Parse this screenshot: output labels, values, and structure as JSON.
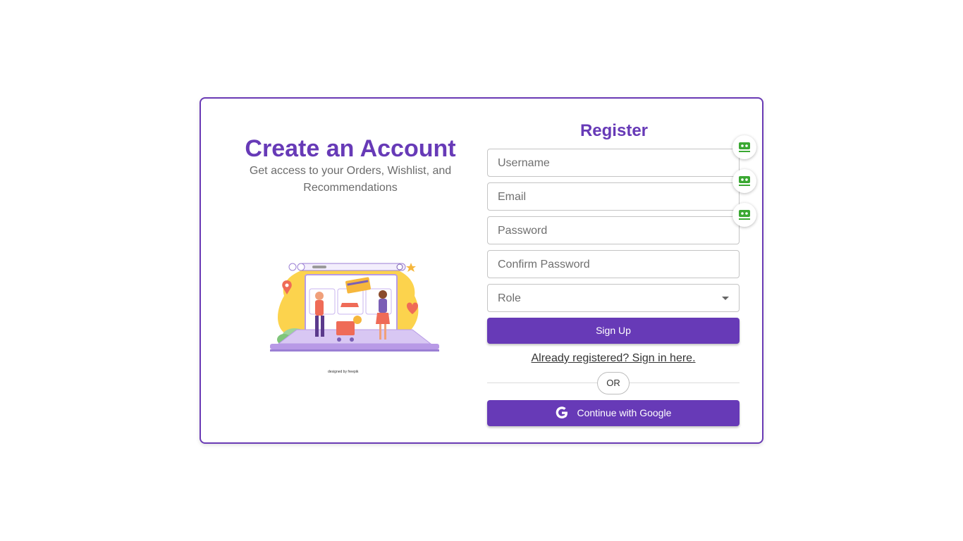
{
  "left_panel": {
    "heading": "Create an Account",
    "subtitle": "Get access to your Orders, Wishlist, and Recommendations",
    "illustration_credit": "designed by freepik"
  },
  "form": {
    "title": "Register",
    "username_placeholder": "Username",
    "email_placeholder": "Email",
    "password_placeholder": "Password",
    "confirm_password_placeholder": "Confirm Password",
    "role_placeholder": "Role",
    "signup_label": "Sign Up",
    "signin_link": "Already registered? Sign in here.",
    "divider_label": "OR",
    "google_label": "Continue with Google"
  },
  "icons": {
    "google": "google-icon",
    "dropdown": "chevron-down-icon",
    "password_manager": "password-manager-icon"
  },
  "colors": {
    "accent": "#673ab7",
    "card_border": "#6a3bb5",
    "badge_green": "#3aa832"
  }
}
